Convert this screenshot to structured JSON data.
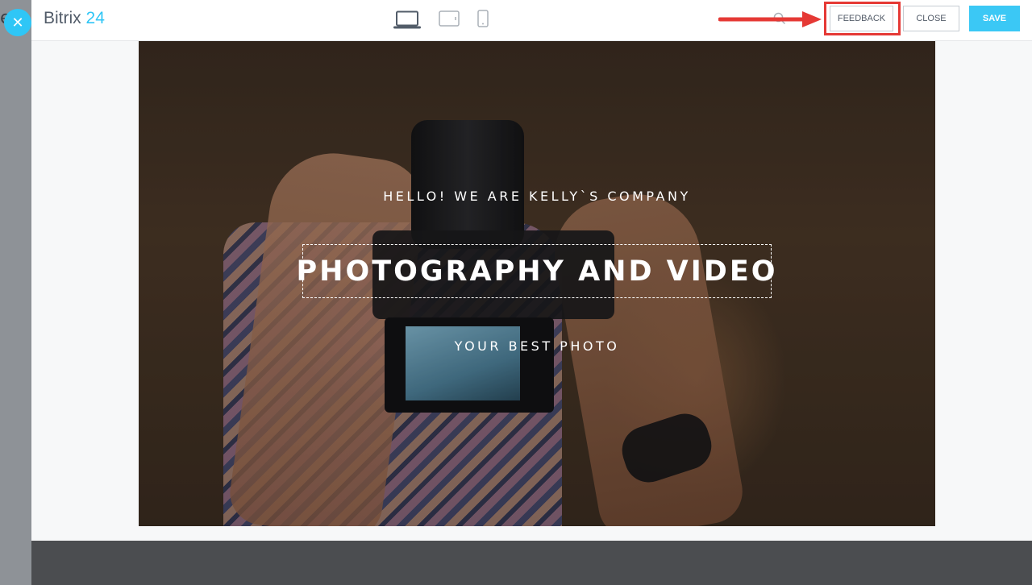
{
  "app": {
    "brand_name": "Bitrix",
    "brand_number": "24"
  },
  "backdrop": {
    "letter": "e"
  },
  "topbar": {
    "devices": [
      "desktop-icon",
      "tablet-icon",
      "mobile-icon"
    ],
    "feedback_label": "FEEDBACK",
    "close_label": "CLOSE",
    "save_label": "SAVE"
  },
  "hero": {
    "subtitle_top": "HELLO! WE ARE KELLY`S COMPANY",
    "title": "PHOTOGRAPHY AND VIDEO",
    "subtitle_bottom": "YOUR BEST PHOTO"
  },
  "colors": {
    "accent": "#2fc6f6",
    "save_button": "#3bc8f5",
    "highlight": "#e53935"
  }
}
